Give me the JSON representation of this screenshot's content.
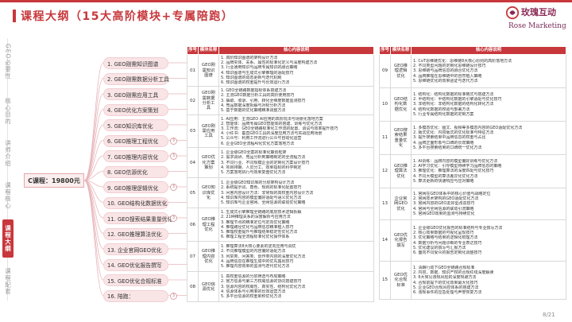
{
  "title": "课程大纲（15大高阶模块+专属陪跑）",
  "logo": {
    "cn": "玫瑰互动",
    "en": "Rose Marketing"
  },
  "sidebar": [
    {
      "label": "GEO必要性",
      "active": false
    },
    {
      "label": "核心目的",
      "active": false
    },
    {
      "label": "讲师介绍",
      "active": false
    },
    {
      "label": "课程核心",
      "active": false
    },
    {
      "label": "课程大纲",
      "active": true
    },
    {
      "label": "课程配套",
      "active": false
    }
  ],
  "root": "C课程：19800元",
  "modules": [
    {
      "label": "1. GEO刚需知识图谱",
      "badge": ""
    },
    {
      "label": "2. GEO刚需数据分析工具",
      "badge": ""
    },
    {
      "label": "3. GEO刚需应用工具",
      "badge": ""
    },
    {
      "label": "4. GEO优化方案策划",
      "badge": ""
    },
    {
      "label": "5. GEO知识库优化",
      "badge": ""
    },
    {
      "label": "6. GEO推理工程优化",
      "badge": "3"
    },
    {
      "label": "7. GEO推理内容优化",
      "badge": "3"
    },
    {
      "label": "8. GEO信源优化",
      "badge": ""
    },
    {
      "label": "9. GEO推理逻辑优化",
      "badge": "3"
    },
    {
      "label": "10. GEO结构化数据优化",
      "badge": ""
    },
    {
      "label": "11. GEO搜索结果重量优化",
      "badge": "3"
    },
    {
      "label": "12. GEO推理算法优化",
      "badge": ""
    },
    {
      "label": "13. 企业官网GEO优化",
      "badge": ""
    },
    {
      "label": "14. GEO优化报告撰写",
      "badge": ""
    },
    {
      "label": "15. GEO优化合规标准",
      "badge": ""
    },
    {
      "label": "16. 陪跑：",
      "badge": "3"
    }
  ],
  "table_headers": {
    "idx": "序号",
    "module": "模块名称",
    "points": "核心内容说明"
  },
  "left_table": [
    {
      "idx": "01",
      "module": "GEO刚需知识图谱",
      "points": [
        "1. 高阶知识图谱的架构设计方法",
        "2. 品牌实体、关系、属性的标准化定义与深度构建方法",
        "3. 行业通用知识与品牌专属知识的融合策略",
        "4. 知识图谱与生成式引擎推理的适配技巧",
        "5. 知识图谱的动态更新与迭代机制",
        "6. 知识图谱的权重提升与长效运行方法"
      ]
    },
    {
      "idx": "02",
      "module": "GEO刚需数据分析工具",
      "points": [
        "1. GEO全链路数据指标体系搭建方法",
        "2. 主流GEO数据分析工具的高阶使用技巧",
        "3. 抽取、收录、引用、转化全维度数据监测技巧",
        "4. 竞品数据深度拆解与对标分析方法",
        "5. 基于数据的优化策略精准调整方法"
      ]
    },
    {
      "idx": "03",
      "module": "GEO刚需应用工具",
      "points": [
        "1. AI应用：主流GEO AI应用的高阶玩法与场景化落地方案",
        "2. 智能体：品牌专属GEO智能体的搭建、训练与优化方法",
        "3. 工作流：GEO全链路标准化工作流的配置、调试与效率提升技巧",
        "4. 小红书：垂直GEO工具的深度应用方法与实战应用场景",
        "5. 公众号：利用工作流进行公众号自动化运营",
        "6. 企业GEO全流程AI化优化方案落地方法"
      ]
    },
    {
      "idx": "04",
      "module": "GEO优化方案策划",
      "points": [
        "1. 企业级GEO全案的标准化策划框架",
        "2. 需求调研、竞品分析到策略制定的全流程方法",
        "3. 不同行业、不同规模企业的定制化方案设计技巧",
        "4. 项目排期、人员分工、效果指标的科学制定",
        "5. 方案落地执行与效果复盘优化方法"
      ]
    },
    {
      "idx": "05",
      "module": "GEO知识库优化",
      "points": [
        "1. 企业级GEO知识库的分层架构设计方法",
        "2. 系统提示词、角色、规则的标准化配置技巧",
        "3. 问答内容设计方法：非常规的高权重内容设计方法",
        "4. 知识库内容的模型偏好适配与语义优化方法",
        "5. 知识库与企业官网、全网信源的联动优化策略"
      ]
    },
    {
      "idx": "06",
      "module": "GEO推理工程优化",
      "points": [
        "1. 生成式引擎推理全链路的底层技术逻辑拆解",
        "2. 21种推理关系的深度解析与应用方法",
        "3. 推理节点的精准定位与定向优化策略",
        "4. 推理路径优化与品牌信息精准植入技巧",
        "5. 推理权重提升与推理结果稳定性优化方法",
        "6. 推理工程全流程标准化优化操作体系"
      ]
    },
    {
      "idx": "07",
      "module": "GEO推理内容优化",
      "points": [
        "1. 推理算法8大核心要素的逆向应用与调优",
        "2. 不同推理模型的内容偏好适配方法",
        "3. 列举类、问答类、创作类内容的深度优化方法",
        "4. 品牌信息在推理生成中的优先露出技巧",
        "5. 推理内容效果的监测与迭代优化方法"
      ]
    },
    {
      "idx": "08",
      "module": "GEO信源优化",
      "points": [
        "1. 高权重信源的分层筛选与布局策略",
        "2. 官方信源与第三方权威信源的协同搭建技巧",
        "3. 信源内容的权威性、真实性、结构化优化方法",
        "4. 信源体系与引用率的长效运营方法",
        "5. 多平台信源的权重累积优化方法"
      ]
    }
  ],
  "right_table": [
    {
      "idx": "09",
      "module": "GEO推理逻辑优化",
      "points": [
        "1. CoT思维链优化：思维链8大核心原则的高阶落地方法",
        "2. 不同类型问题的定制化思维链设计技巧",
        "3. 思维链与品牌信息的融合优化方法",
        "4. 品牌推理在思维链中的自然植入策略",
        "5. 思维链优化的效果验证与迭代方法"
      ]
    },
    {
      "idx": "10",
      "module": "GEO结构化数据优化",
      "points": [
        "1. 结构化：结构化数据的标准格式与搭建方法",
        "2. 半结构化：半结构化数据的引擎适配与优化技巧",
        "3. 非结构化：非结构化数据的结构化转化方法",
        "4. 结构化数据的校验与部署方法",
        "5. 行业专属结构化数据的定制方案"
      ]
    },
    {
      "idx": "11",
      "module": "GEO搜索结果重量优化",
      "points": [
        "1. 多模态优化：图文、视频等多模态内容的GEO适配优化方法",
        "2. 版式优化：内容版式的优化标准与特征方法",
        "3. 提升搜索结果中品牌信息的权重与占比",
        "4. 品牌正面形象与口碑的长效策略",
        "5. 多平台搜索结果的口碑统一优化方法"
      ]
    },
    {
      "idx": "12",
      "module": "GEO推理算法优化",
      "points": [
        "1. AI训练：品牌内容的模型偏好训练与优化方法",
        "2. AI学习优化：引导模型持续学习品牌信息的策略",
        "3. 推理优化：推理算法的深度匹配与优化技巧",
        "4. 不同大模型的算法差异化优化方法",
        "5. 算法更新的快速响应与应对策略"
      ]
    },
    {
      "idx": "13",
      "module": "企业官网GEO优化",
      "points": [
        "1. 官网在GEO体系中的核心价值与战略定位",
        "2. 官网技术架构的GEO适配优化方法",
        "3. 官网内容的GEO友好型改造技巧",
        "4. 官网与全网信源的联动引流策略",
        "5. 官网GEO效果的监测与持续优化"
      ]
    },
    {
      "idx": "14",
      "module": "GEO优化报告撰写",
      "points": [
        "1. 企业级GEO优化报告的标准结构与专业撰写方法",
        "2. 核心效果数据的可视化呈现技巧",
        "3. 优化策略与结果的逻辑化梳理方法",
        "4. 数据分析与问题诊断的专业表达技巧",
        "5. 优化建议的撰写与汇报方法",
        "6. 面向不同受众的报告定制化调整技巧"
      ]
    },
    {
      "idx": "15",
      "module": "GEO优化合规标准",
      "points": [
        "1. 清朗行动下GEO全链路合规标准",
        "2. 内容、数据、知识产权的合规红线深度解读",
        "3. 6大常见违规风险的深度规避方法",
        "4. 合规前提下的优化效果最大化技巧",
        "5. 企业GEO合规风控体系的搭建方法",
        "6. 违规事件的应急处理与声誉恢复方法"
      ]
    }
  ],
  "page_number": "8/21",
  "colors": {
    "accent": "#c7373b",
    "node_fill": "#f9e4e6",
    "root_fill": "#fbeeee"
  }
}
